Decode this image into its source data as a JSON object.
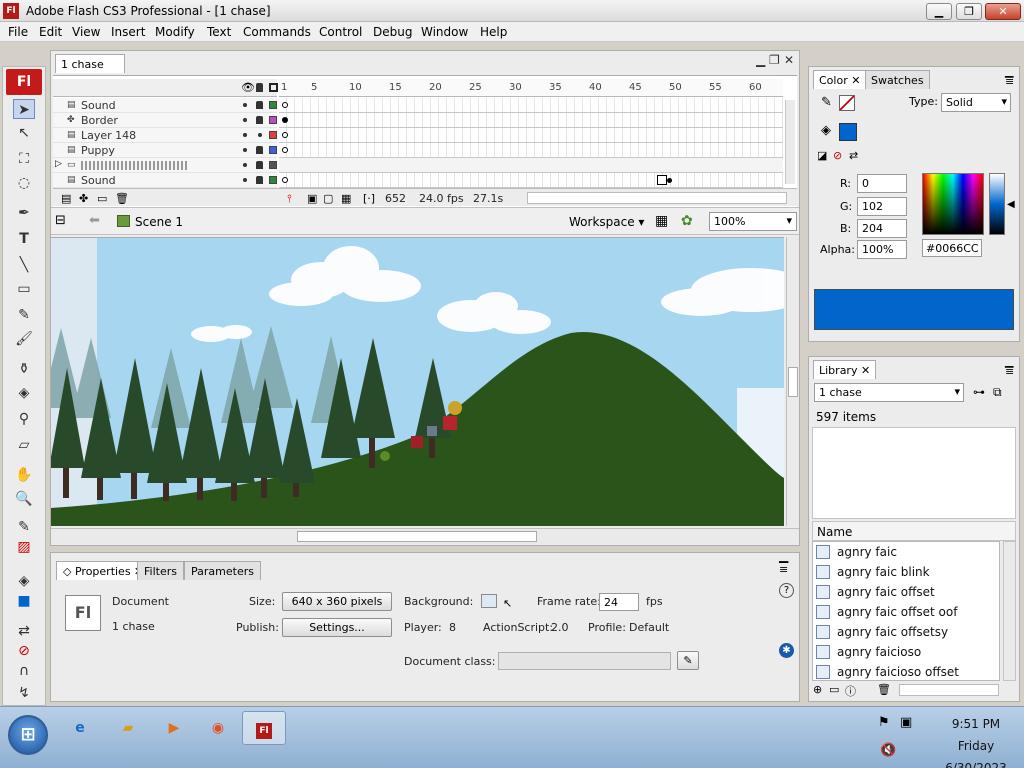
{
  "window": {
    "title": "Adobe Flash CS3 Professional - [1 chase]",
    "logo": "Fl",
    "minimize": "▁",
    "maximize": "❐",
    "close": "✕"
  },
  "menu": [
    "File",
    "Edit",
    "View",
    "Insert",
    "Modify",
    "Text",
    "Commands",
    "Control",
    "Debug",
    "Window",
    "Help"
  ],
  "document": {
    "tab": "1 chase",
    "layers": [
      {
        "name": "Sound",
        "icon": "layer-icon",
        "keyframe": "empty"
      },
      {
        "name": "Border",
        "icon": "guide-icon",
        "keyframe": "filled"
      },
      {
        "name": "Layer 148",
        "icon": "layer-icon",
        "keyframe": "empty"
      },
      {
        "name": "Puppy",
        "icon": "layer-icon",
        "keyframe": "empty"
      },
      {
        "name": "",
        "icon": "folder-icon",
        "keyframe": "none"
      },
      {
        "name": "Sound",
        "icon": "layer-icon",
        "keyframe": "empty"
      }
    ],
    "ruler_ticks": [
      "1",
      "5",
      "10",
      "15",
      "20",
      "25",
      "30",
      "35",
      "40",
      "45",
      "50",
      "55",
      "60"
    ],
    "current_frame": "652",
    "frame_rate": "24.0 fps",
    "elapsed_time": "27.1s",
    "scene": "Scene 1",
    "workspace": "Workspace ▾",
    "zoom": "100%"
  },
  "properties": {
    "tabs": [
      "Properties",
      "Filters",
      "Parameters"
    ],
    "type_label": "Document",
    "doc_name": "1 chase",
    "size_label": "Size:",
    "size_value": "640 x 360 pixels",
    "publish_label": "Publish:",
    "settings_button": "Settings...",
    "background_label": "Background:",
    "player_label": "Player:",
    "player_value": "8",
    "actionscript_label": "ActionScript:",
    "actionscript_value": "2.0",
    "framerate_label": "Frame rate:",
    "framerate_value": "24",
    "fps_label": "fps",
    "profile_label": "Profile:",
    "profile_value": "Default",
    "docclass_label": "Document class:",
    "fl_badge": "Fl"
  },
  "color_panel": {
    "tabs": [
      "Color",
      "Swatches"
    ],
    "type_label": "Type:",
    "type_value": "Solid",
    "r_label": "R:",
    "r_value": "0",
    "g_label": "G:",
    "g_value": "102",
    "b_label": "B:",
    "b_value": "204",
    "alpha_label": "Alpha:",
    "alpha_value": "100%",
    "hex": "#0066CC",
    "current_color": "#0066cc"
  },
  "library": {
    "tab": "Library",
    "selected_doc": "1 chase",
    "count": "597 items",
    "name_header": "Name",
    "items": [
      "agnry faic",
      "agnry faic blink",
      "agnry faic offset",
      "agnry faic offset oof",
      "agnry faic offsetsy",
      "agnry faicioso",
      "agnry faicioso offset"
    ]
  },
  "taskbar": {
    "start": "⊞",
    "time": "9:51 PM",
    "day": "Friday",
    "date": "6/30/2023"
  }
}
